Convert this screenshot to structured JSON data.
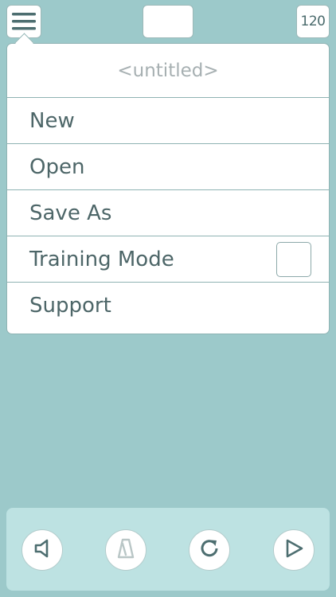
{
  "topbar": {
    "menu_icon": "hamburger-icon",
    "center_field": "",
    "tempo": "120"
  },
  "menu": {
    "title": "<untitled>",
    "items": [
      {
        "label": "New"
      },
      {
        "label": "Open"
      },
      {
        "label": "Save As"
      },
      {
        "label": "Training Mode",
        "checkbox": false
      },
      {
        "label": "Support"
      }
    ]
  },
  "toolbar": {
    "buttons": [
      {
        "icon": "speaker-icon",
        "enabled": true
      },
      {
        "icon": "metronome-icon",
        "enabled": false
      },
      {
        "icon": "loop-icon",
        "enabled": true
      },
      {
        "icon": "play-icon",
        "enabled": true
      }
    ]
  },
  "colors": {
    "background": "#9cc9ca",
    "toolbar": "#bde2e2",
    "text": "#4d6668",
    "placeholder_text": "#a7b0b2",
    "icon": "#4d6e70",
    "icon_disabled": "#b9c6c6"
  }
}
